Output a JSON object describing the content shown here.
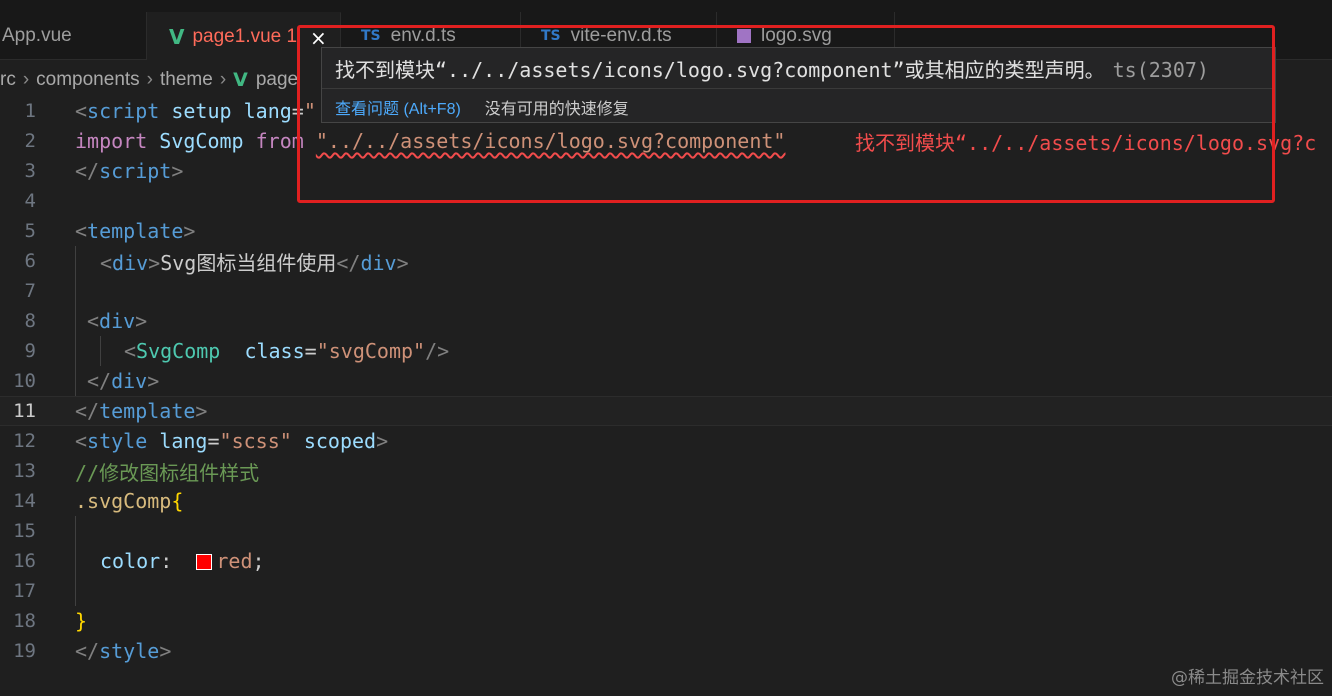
{
  "tabs": [
    {
      "label": "App.vue",
      "icon": "vue-icon"
    },
    {
      "label": "page1.vue 1",
      "icon": "vue-icon",
      "active": true
    },
    {
      "label": "env.d.ts",
      "icon": "ts-icon"
    },
    {
      "label": "vite-env.d.ts",
      "icon": "ts-icon"
    },
    {
      "label": "logo.svg",
      "icon": "svg-file-icon"
    }
  ],
  "breadcrumb": [
    "rc",
    "components",
    "theme",
    "page"
  ],
  "hover": {
    "message": "找不到模块“../../assets/icons/logo.svg?component”或其相应的类型声明。",
    "code": "ts(2307)",
    "view_problem": "查看问题 (Alt+F8)",
    "no_quick_fix": "没有可用的快速修复",
    "close_glyph": "×"
  },
  "editor": {
    "line_numbers": [
      "1",
      "2",
      "3",
      "4",
      "5",
      "6",
      "7",
      "8",
      "9",
      "10",
      "11",
      "12",
      "13",
      "14",
      "15",
      "16",
      "17",
      "18",
      "19"
    ],
    "current_line": "11",
    "l1": {
      "lt": "<",
      "tag": "script",
      "attr1": "setup",
      "attr2": "lang",
      "eq": "=",
      "quote": "\""
    },
    "l2": {
      "kw1": "import",
      "id": "SvgComp",
      "kw2": "from",
      "path": "\"../../assets/icons/logo.svg?component\"",
      "inline_error": "找不到模块“../../assets/icons/logo.svg?c"
    },
    "l3": {
      "open": "</",
      "tag": "script",
      "close": ">"
    },
    "l5": {
      "open": "<",
      "tag": "template",
      "close": ">"
    },
    "l6": {
      "open": "<",
      "tag": "div",
      "close": ">",
      "text": "Svg图标当组件使用",
      "end_open": "</",
      "end_tag": "div",
      "end_close": ">"
    },
    "l8": {
      "open": "<",
      "tag": "div",
      "close": ">"
    },
    "l9": {
      "open": "<",
      "tag": "SvgComp",
      "attr": "class",
      "eq": "=",
      "val": "\"svgComp\"",
      "close": "/>"
    },
    "l10": {
      "open": "</",
      "tag": "div",
      "close": ">"
    },
    "l11": {
      "open": "</",
      "tag": "template",
      "close": ">"
    },
    "l12": {
      "open": "<",
      "tag": "style",
      "attr1": "lang",
      "eq": "=",
      "val": "\"scss\"",
      "attr2": "scoped",
      "close": ">"
    },
    "l13": {
      "comment": "//修改图标组件样式"
    },
    "l14": {
      "selector": ".svgComp",
      "brace": "{"
    },
    "l16": {
      "prop": "color",
      "colon": ":",
      "value": "red",
      "semi": ";",
      "swatch_color": "#ff0000"
    },
    "l18": {
      "brace": "}"
    },
    "l19": {
      "open": "</",
      "tag": "style",
      "close": ">"
    }
  },
  "colors": {
    "error": "#f14c4c",
    "annotation": "#e02020",
    "link": "#4daafc"
  },
  "watermark": "@稀土掘金技术社区"
}
